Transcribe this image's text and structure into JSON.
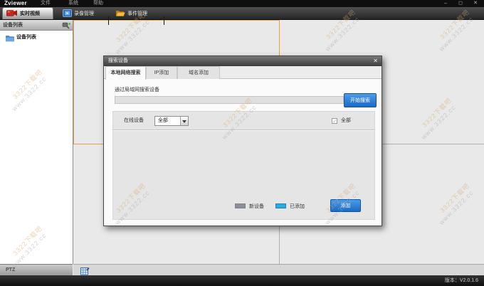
{
  "app": {
    "logo": "Zviewer",
    "menus": [
      "文件",
      "系统",
      "帮助"
    ],
    "window_controls": {
      "minimize": "–",
      "maximize": "◻",
      "close": "✕"
    },
    "version": "版本：V2.0.1.6"
  },
  "main_tabs": [
    {
      "label": "实时视频",
      "icon": "camera-icon",
      "active": true
    },
    {
      "label": "录像管理",
      "icon": "film-icon",
      "active": false
    },
    {
      "label": "事件管理",
      "icon": "folder-icon",
      "active": false
    }
  ],
  "sidebar": {
    "header": "设备列表",
    "tree_item": "设备列表",
    "ptz": "PTZ"
  },
  "dialog": {
    "title": "搜索设备",
    "close": "✕",
    "tabs": [
      {
        "label": "本地网络搜索",
        "active": true
      },
      {
        "label": "IP添加",
        "active": false
      },
      {
        "label": "域名添加",
        "active": false
      }
    ],
    "lan_search_label": "通过局域网搜索设备",
    "start_search": "开始搜索",
    "online_device": "在线设备",
    "online_filter_value": "全部",
    "select_all": "全部",
    "legend": [
      {
        "label": "新设备",
        "color": "#8a9097"
      },
      {
        "label": "已添加",
        "color": "#29abe2"
      }
    ],
    "add_button": "添加"
  },
  "watermark": {
    "line1": "3322下载吧",
    "line2": "www.3322.cc"
  }
}
